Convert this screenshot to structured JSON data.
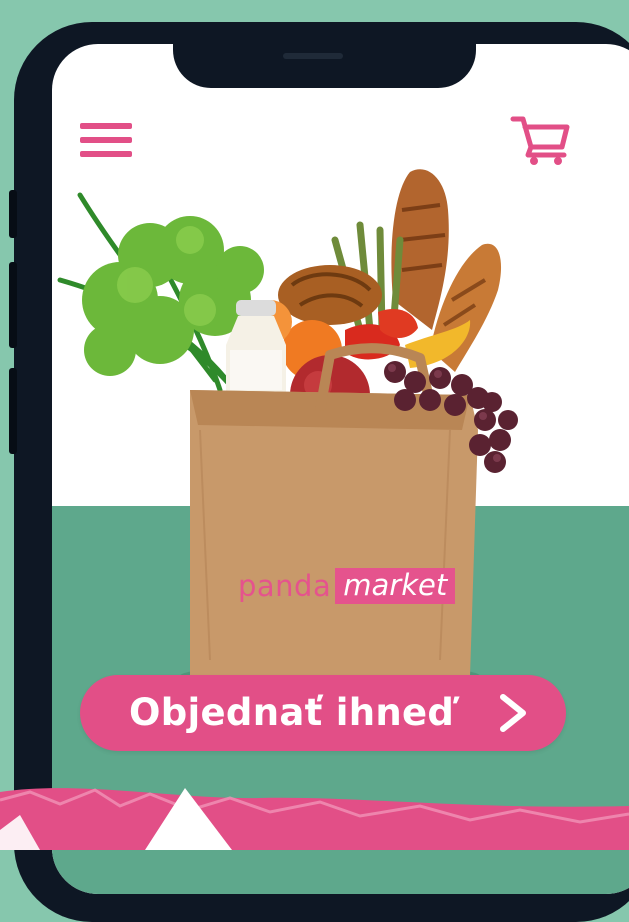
{
  "header": {
    "menu_icon": "hamburger-menu-icon",
    "cart_icon": "shopping-cart-icon"
  },
  "hero": {
    "image": "grocery-bag-image",
    "bag_brand": {
      "part1": "panda",
      "part2": "market"
    }
  },
  "cta": {
    "label": "Objednať ihneď",
    "icon": "chevron-right-icon"
  },
  "colors": {
    "accent": "#e24f87",
    "background": "#86c7ad",
    "ground": "#5ea88c",
    "frame": "#0e1724",
    "bag": "#c8996a"
  }
}
